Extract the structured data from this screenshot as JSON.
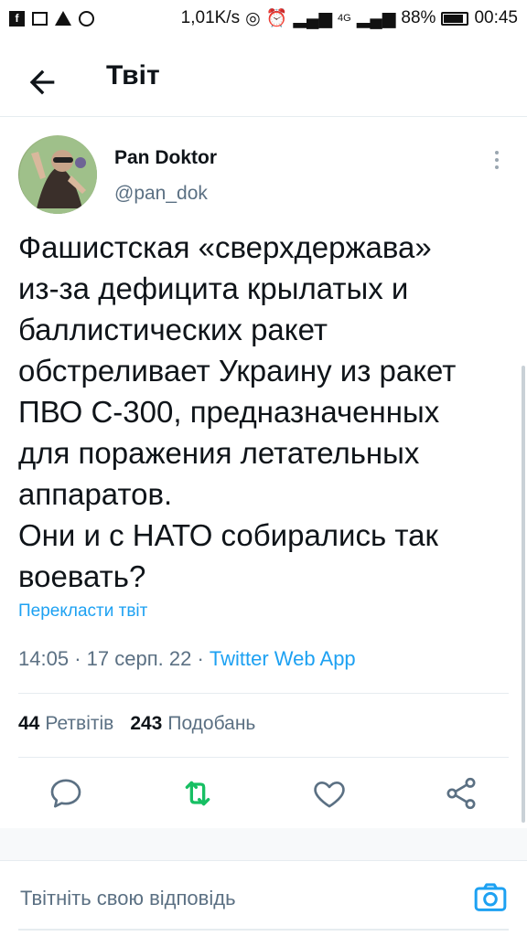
{
  "status_bar": {
    "speed": "1,01K/s",
    "network": "4G",
    "battery": "88%",
    "time": "00:45"
  },
  "header": {
    "title": "Твіт"
  },
  "tweet": {
    "author_name": "Pan Doktor",
    "author_handle": "@pan_dok",
    "text": "Фашистская «сверхдержава»\nиз-за дефицита крылатых и\nбаллистических ракет\nобстреливает Украину из ракет\nПВО С-300, предназначенных\nдля поражения летательных\nаппаратов.\nОни и с НАТО собирались так\nвоевать?",
    "translate_label": "Перекласти твіт",
    "time": "14:05",
    "date": "17 серп. 22",
    "source_app": "Twitter Web App",
    "retweets_count": "44",
    "retweets_label": "Ретвітів",
    "likes_count": "243",
    "likes_label": "Подобань"
  },
  "reply": {
    "placeholder": "Твітніть свою відповідь"
  },
  "colors": {
    "accent": "#1da1f2",
    "retweet": "#17bf63",
    "secondary_text": "#5b7083"
  },
  "icons": {
    "back": "arrow-left-icon",
    "more": "more-vertical-icon",
    "reply": "comment-icon",
    "retweet": "retweet-icon",
    "like": "heart-icon",
    "share": "share-icon",
    "camera": "camera-icon"
  }
}
